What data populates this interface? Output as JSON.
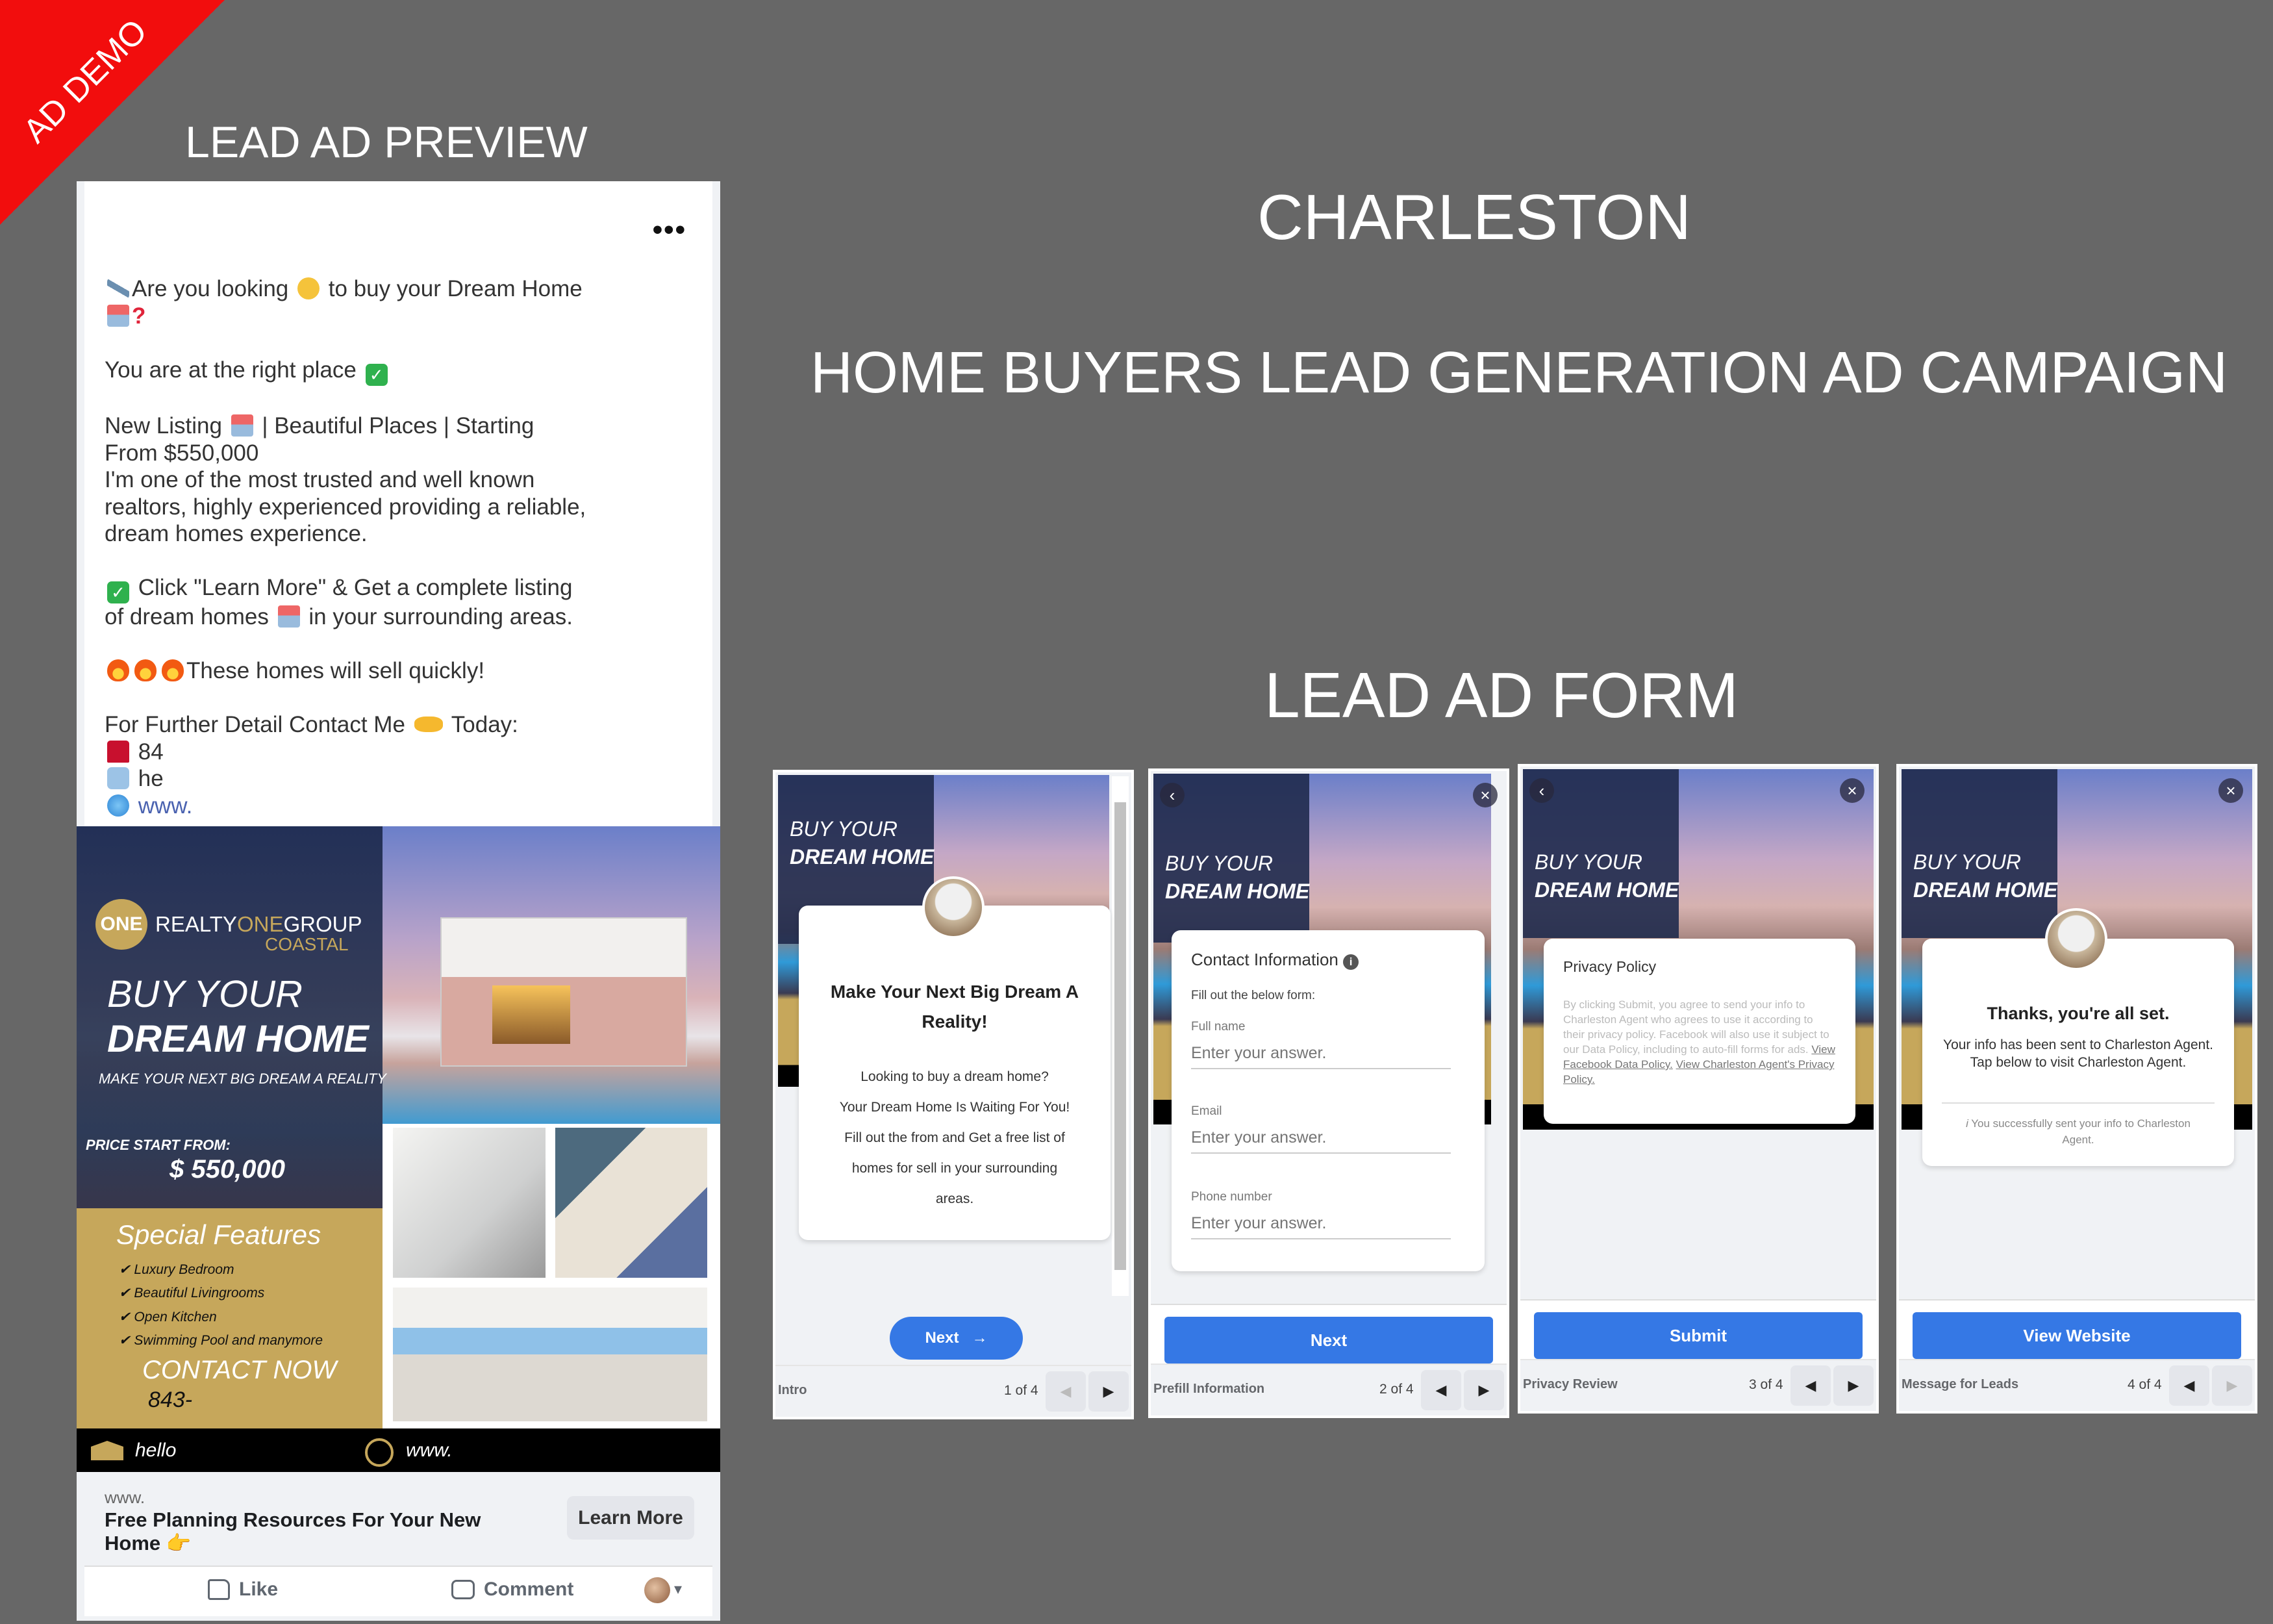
{
  "corner_badge": "AD DEMO",
  "headings": {
    "preview": "LEAD AD PREVIEW",
    "city": "CHARLESTON",
    "campaign": "HOME BUYERS LEAD GENERATION AD CAMPAIGN",
    "form": "LEAD AD FORM"
  },
  "post": {
    "more_icon": "more-horizontal-icon",
    "lines": {
      "l1a": "Are you looking",
      "l1b": "to buy your Dream Home",
      "l2": "?",
      "l3": "You are at the right place",
      "l4a": "New Listing",
      "l4b": "| Beautiful Places | Starting",
      "l5": "From $550,000",
      "l6": "I'm one of the most trusted and well known",
      "l7": "realtors, highly experienced providing a reliable,",
      "l8": "dream homes experience.",
      "l9": "Click \"Learn More\" & Get a complete listing",
      "l10a": "of dream homes",
      "l10b": "in your surrounding areas.",
      "l11": "These homes will sell quickly!",
      "l12a": "For Further Detail Contact Me",
      "l12b": "Today:",
      "phone": "84",
      "email": "he",
      "web": "www."
    }
  },
  "ad_image": {
    "logo": "ONE",
    "brand_a": "REALTY",
    "brand_b": "ONE",
    "brand_c": "GROUP",
    "coastal": "COASTAL",
    "buy": "BUY YOUR",
    "dream": "DREAM HOME",
    "tagline": "MAKE YOUR NEXT BIG DREAM A REALITY",
    "price_label": "PRICE START FROM:",
    "price": "$ 550,000",
    "features_title": "Special Features",
    "features": [
      "✔ Luxury Bedroom",
      "✔ Beautiful Livingrooms",
      "✔ Open Kitchen",
      "✔ Swimming Pool and manymore"
    ],
    "contact": "CONTACT NOW",
    "phone": "843-",
    "email": "hello",
    "web": "www."
  },
  "link_bar": {
    "domain": "www.",
    "headline": "Free Planning Resources For Your New Home 👉",
    "cta": "Learn More"
  },
  "actions": {
    "like": "Like",
    "comment": "Comment"
  },
  "forms": [
    {
      "header_buy": "BUY YOUR",
      "header_dream": "DREAM HOME",
      "title": "Make Your Next Big Dream A Reality!",
      "body": [
        "Looking to buy a dream home?",
        "Your Dream Home Is Waiting For You!",
        "Fill out the from and Get a free list of",
        "homes for sell in your surrounding",
        "areas."
      ],
      "button": "Next",
      "step": "Intro",
      "count": "1 of 4"
    },
    {
      "header_buy": "BUY YOUR",
      "header_dream": "DREAM HOME",
      "title": "Contact Information",
      "subtitle": "Fill out the below form:",
      "fields": [
        {
          "label": "Full name",
          "placeholder": "Enter your answer."
        },
        {
          "label": "Email",
          "placeholder": "Enter your answer."
        },
        {
          "label": "Phone number",
          "placeholder": "Enter your answer."
        }
      ],
      "button": "Next",
      "step": "Prefill Information",
      "count": "2 of 4"
    },
    {
      "header_buy": "BUY YOUR",
      "header_dream": "DREAM HOME",
      "title": "Privacy Policy",
      "body": "By clicking Submit, you agree to send your info to Charleston Agent who agrees to use it according to their privacy policy. Facebook will also use it subject to our Data Policy, including to auto-fill forms for ads.",
      "link1": "View Facebook Data Policy.",
      "link2": "View Charleston Agent's Privacy Policy.",
      "button": "Submit",
      "step": "Privacy Review",
      "count": "3 of 4"
    },
    {
      "header_buy": "BUY YOUR",
      "header_dream": "DREAM HOME",
      "title": "Thanks, you're all set.",
      "body": "Your info has been sent to Charleston Agent. Tap below to visit Charleston Agent.",
      "note": "You successfully sent your info to Charleston Agent.",
      "button": "View Website",
      "step": "Message for Leads",
      "count": "4 of 4"
    }
  ],
  "colors": {
    "background": "#676767",
    "badge": "#f20d0d",
    "gold": "#c6a75b",
    "navy": "#1f2a4d",
    "button_blue": "#3578e5"
  }
}
